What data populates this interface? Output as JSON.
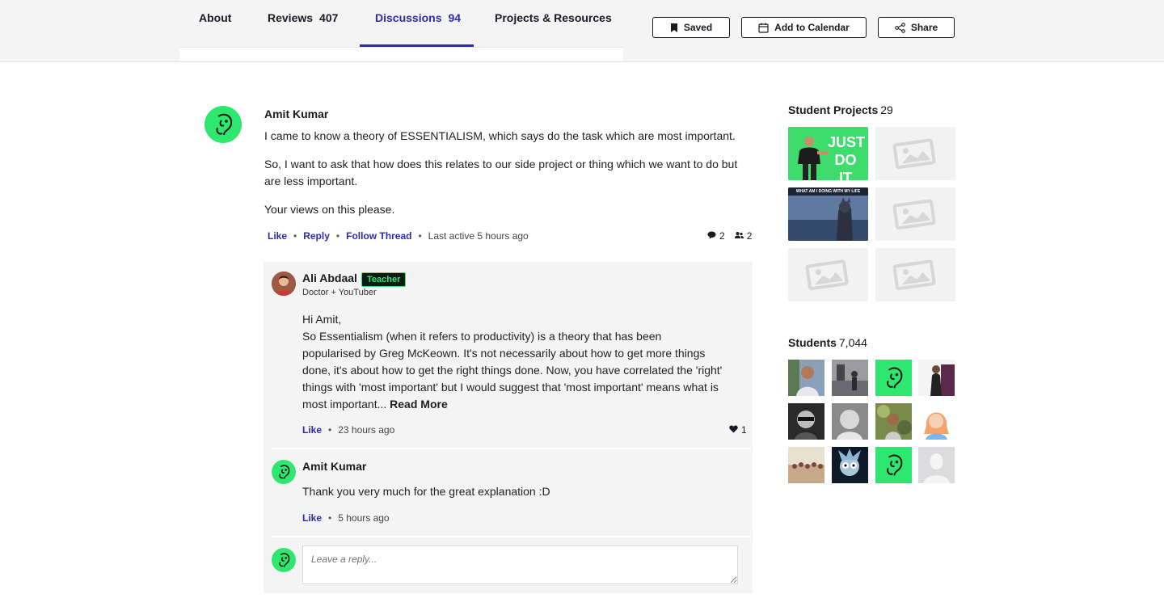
{
  "tabs": [
    {
      "label": "About",
      "count": ""
    },
    {
      "label": "Reviews",
      "count": "407"
    },
    {
      "label": "Discussions",
      "count": "94"
    },
    {
      "label": "Projects & Resources",
      "count": ""
    }
  ],
  "header_buttons": {
    "saved": "Saved",
    "calendar": "Add to Calendar",
    "share": "Share"
  },
  "thread": {
    "author": "Amit Kumar",
    "paragraphs": [
      "I came to know a theory of ESSENTIALISM, which says do the task which are most important.",
      "So, I want to ask that how does this relates to our side project or thing which we want to do but are less important.",
      "Your views on this please."
    ],
    "like": "Like",
    "reply": "Reply",
    "follow": "Follow Thread",
    "last_active": "Last active 5 hours ago",
    "comments_count": "2",
    "followers_count": "2"
  },
  "replies": [
    {
      "author": "Ali Abdaal",
      "badge": "Teacher",
      "subtitle": "Doctor + YouTuber",
      "greeting": "Hi Amit,",
      "body": "So Essentialism (when it refers to productivity) is a theory that has been popularised by Greg McKeown. It's not necessarily about how to get more things done, it's about how to get the right things done. Now, you have correlated the 'right' things with 'most important' but I would suggest that 'most important' means what is most important...",
      "read_more": "Read More",
      "like": "Like",
      "time": "23 hours ago",
      "likes": "1"
    },
    {
      "author": "Amit Kumar",
      "body": "Thank you very much for the great explanation :D",
      "like": "Like",
      "time": "5 hours ago"
    }
  ],
  "reply_input": {
    "placeholder": "Leave a reply..."
  },
  "sidebar": {
    "projects_title": "Student Projects",
    "projects_count": "29",
    "project_thumb_text": "JUST DO IT",
    "project_thumb2_text": "WHAT AM I DOING WITH MY LIFE",
    "students_title": "Students",
    "students_count": "7,044"
  },
  "colors": {
    "accent": "#2b2bb5",
    "brand_green": "#2ee76f"
  },
  "icons": [
    "bookmark-icon",
    "calendar-icon",
    "share-icon",
    "comment-icon",
    "followers-icon",
    "heart-icon",
    "image-placeholder-icon"
  ]
}
